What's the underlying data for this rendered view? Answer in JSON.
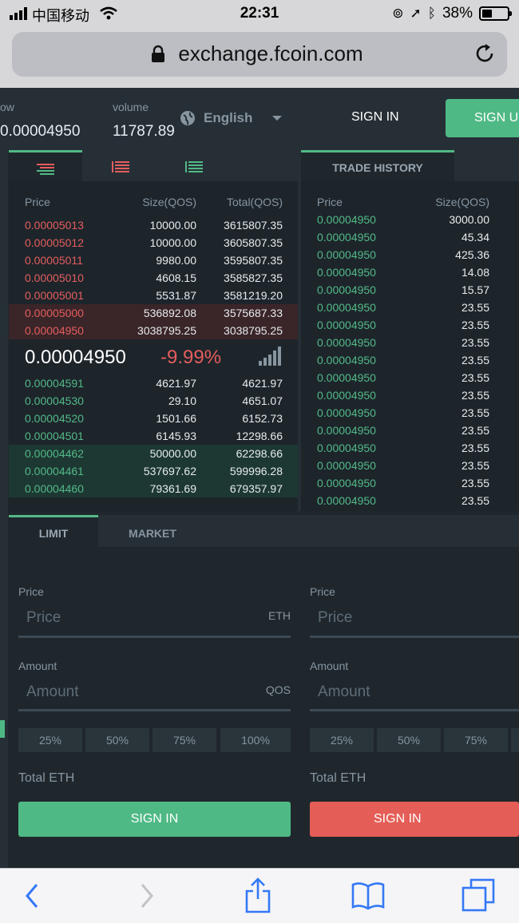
{
  "status": {
    "carrier": "中国移动",
    "time": "22:31",
    "battery": "38%"
  },
  "browser": {
    "url": "exchange.fcoin.com"
  },
  "header": {
    "low_label": "ow",
    "low_value": "0.00004950",
    "volume_label": "volume",
    "volume_value": "11787.89",
    "language": "English",
    "signin": "SIGN IN",
    "signup": "SIGN UP"
  },
  "orderbook": {
    "headers": {
      "price": "Price",
      "size": "Size(QOS)",
      "total": "Total(QOS)"
    },
    "asks": [
      {
        "price": "0.00005013",
        "size": "10000.00",
        "total": "3615807.35"
      },
      {
        "price": "0.00005012",
        "size": "10000.00",
        "total": "3605807.35"
      },
      {
        "price": "0.00005011",
        "size": "9980.00",
        "total": "3595807.35"
      },
      {
        "price": "0.00005010",
        "size": "4608.15",
        "total": "3585827.35"
      },
      {
        "price": "0.00005001",
        "size": "5531.87",
        "total": "3581219.20"
      },
      {
        "price": "0.00005000",
        "size": "536892.08",
        "total": "3575687.33"
      },
      {
        "price": "0.00004950",
        "size": "3038795.25",
        "total": "3038795.25"
      }
    ],
    "last_price": "0.00004950",
    "change": "-9.99%",
    "bids": [
      {
        "price": "0.00004591",
        "size": "4621.97",
        "total": "4621.97"
      },
      {
        "price": "0.00004530",
        "size": "29.10",
        "total": "4651.07"
      },
      {
        "price": "0.00004520",
        "size": "1501.66",
        "total": "6152.73"
      },
      {
        "price": "0.00004501",
        "size": "6145.93",
        "total": "12298.66"
      },
      {
        "price": "0.00004462",
        "size": "50000.00",
        "total": "62298.66"
      },
      {
        "price": "0.00004461",
        "size": "537697.62",
        "total": "599996.28"
      },
      {
        "price": "0.00004460",
        "size": "79361.69",
        "total": "679357.97"
      }
    ]
  },
  "trade_history": {
    "tab": "TRADE HISTORY",
    "headers": {
      "price": "Price",
      "size": "Size(QOS)"
    },
    "rows": [
      {
        "price": "0.00004950",
        "size": "3000.00"
      },
      {
        "price": "0.00004950",
        "size": "45.34"
      },
      {
        "price": "0.00004950",
        "size": "425.36"
      },
      {
        "price": "0.00004950",
        "size": "14.08"
      },
      {
        "price": "0.00004950",
        "size": "15.57"
      },
      {
        "price": "0.00004950",
        "size": "23.55"
      },
      {
        "price": "0.00004950",
        "size": "23.55"
      },
      {
        "price": "0.00004950",
        "size": "23.55"
      },
      {
        "price": "0.00004950",
        "size": "23.55"
      },
      {
        "price": "0.00004950",
        "size": "23.55"
      },
      {
        "price": "0.00004950",
        "size": "23.55"
      },
      {
        "price": "0.00004950",
        "size": "23.55"
      },
      {
        "price": "0.00004950",
        "size": "23.55"
      },
      {
        "price": "0.00004950",
        "size": "23.55"
      },
      {
        "price": "0.00004950",
        "size": "23.55"
      },
      {
        "price": "0.00004950",
        "size": "23.55"
      },
      {
        "price": "0.00004950",
        "size": "23.55"
      }
    ]
  },
  "trade_form": {
    "tabs": {
      "limit": "LIMIT",
      "market": "MARKET"
    },
    "buy": {
      "price_label": "Price",
      "price_placeholder": "Price",
      "price_unit": "ETH",
      "amount_label": "Amount",
      "amount_placeholder": "Amount",
      "amount_unit": "QOS",
      "pcts": [
        "25%",
        "50%",
        "75%",
        "100%"
      ],
      "total_label": "Total ETH",
      "button": "SIGN IN"
    },
    "sell": {
      "price_label": "Price",
      "price_placeholder": "Price",
      "amount_label": "Amount",
      "amount_placeholder": "Amount",
      "pcts": [
        "25%",
        "50%",
        "75%"
      ],
      "total_label": "Total ETH",
      "button": "SIGN IN"
    }
  },
  "icons": {
    "wifi": "wifi-icon",
    "lock": "lock-icon",
    "reload": "reload-icon",
    "globe": "globe-icon",
    "back": "chevron-left-icon",
    "forward": "chevron-right-icon",
    "share": "share-icon",
    "bookmarks": "book-icon",
    "tabs": "tabs-icon",
    "signal": "signal-bars-icon"
  },
  "colors": {
    "green": "#53b987",
    "red": "#e65d5d",
    "bg": "#1f272d"
  }
}
